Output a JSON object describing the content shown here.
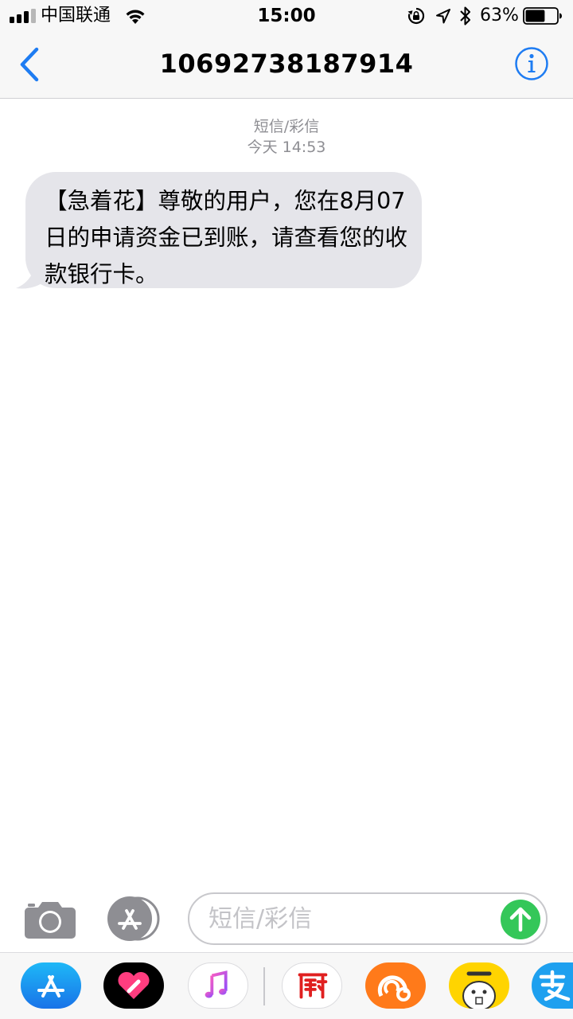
{
  "status_bar": {
    "carrier": "中国联通",
    "time": "15:00",
    "battery_percent": "63%",
    "battery_level": 0.63,
    "icons": [
      "signal-icon",
      "wifi-icon",
      "rotation-lock-icon",
      "location-icon",
      "bluetooth-icon",
      "battery-icon"
    ]
  },
  "nav": {
    "title": "10692738187914",
    "back_icon": "chevron-left-icon",
    "info_icon": "info-icon"
  },
  "thread": {
    "message_type": "短信/彩信",
    "timestamp": "今天 14:53",
    "messages": [
      {
        "direction": "incoming",
        "text": "【急着花】尊敬的用户，您在8月07日的申请资金已到账，请查看您的收款银行卡。"
      }
    ]
  },
  "composer": {
    "placeholder": "短信/彩信",
    "camera_icon": "camera-icon",
    "apps_icon": "app-store-icon",
    "send_icon": "send-arrow-icon"
  },
  "app_drawer": {
    "apps": [
      "app-store",
      "digital-touch",
      "music",
      "recipe-app",
      "uc-browser",
      "mr-hi",
      "alipay"
    ]
  },
  "colors": {
    "accent": "#1e7cf2",
    "bubble_incoming": "#e5e5ea",
    "send_green": "#34c759",
    "meta_gray": "#8e8e93"
  }
}
